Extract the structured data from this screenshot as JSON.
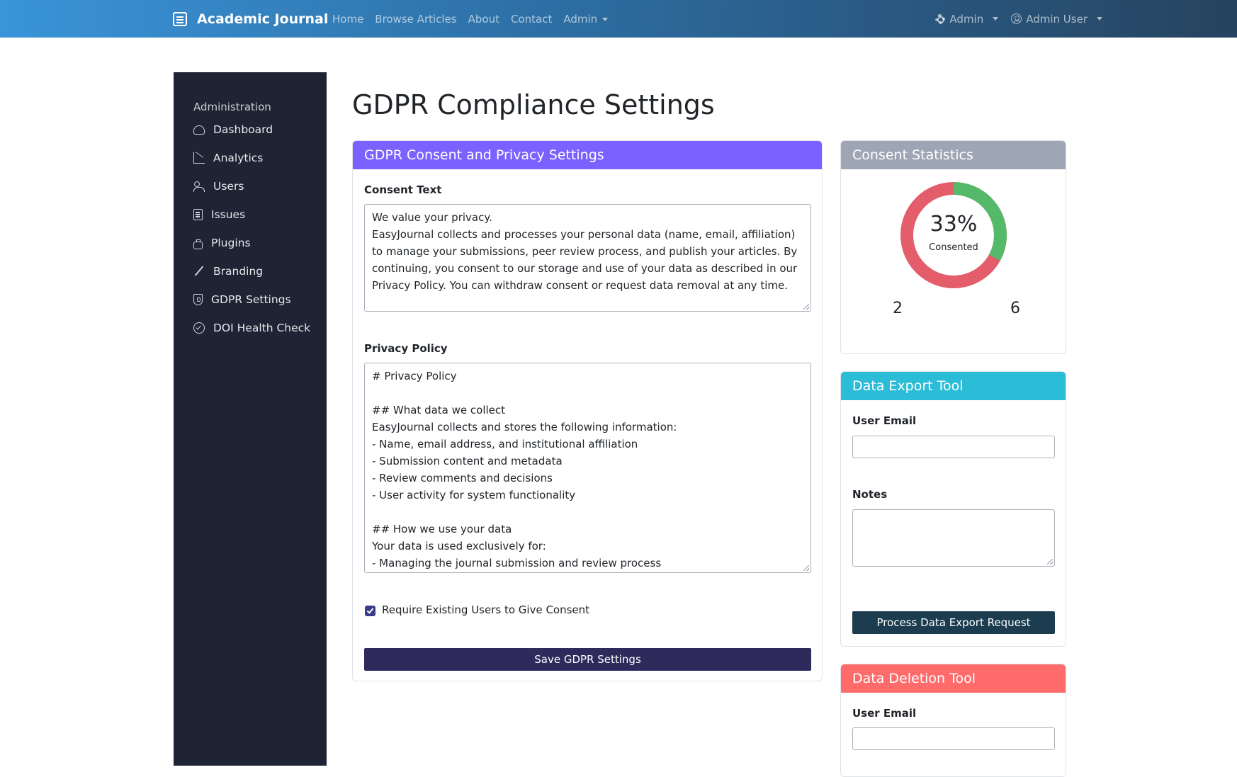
{
  "navbar": {
    "brand": "Academic Journal",
    "links": [
      "Home",
      "Browse Articles",
      "About",
      "Contact",
      "Admin"
    ],
    "right": {
      "admin_menu": "Admin",
      "user_menu": "Admin User"
    }
  },
  "sidebar": {
    "heading": "Administration",
    "items": [
      {
        "label": "Dashboard",
        "icon": "gauge-icon"
      },
      {
        "label": "Analytics",
        "icon": "chart-icon"
      },
      {
        "label": "Users",
        "icon": "users-icon"
      },
      {
        "label": "Issues",
        "icon": "document-icon"
      },
      {
        "label": "Plugins",
        "icon": "plugin-icon"
      },
      {
        "label": "Branding",
        "icon": "brush-icon"
      },
      {
        "label": "GDPR Settings",
        "icon": "shield-icon"
      },
      {
        "label": "DOI Health Check",
        "icon": "check-circle-icon"
      }
    ]
  },
  "page": {
    "title": "GDPR Compliance Settings"
  },
  "consent_card": {
    "header": "GDPR Consent and Privacy Settings",
    "header_color": "#7b61ff",
    "consent_label": "Consent Text",
    "consent_value": "We value your privacy.\nEasyJournal collects and processes your personal data (name, email, affiliation) to manage your submissions, peer review process, and publish your articles. By continuing, you consent to our storage and use of your data as described in our Privacy Policy. You can withdraw consent or request data removal at any time.",
    "privacy_label": "Privacy Policy",
    "privacy_value": "# Privacy Policy\n\n## What data we collect\nEasyJournal collects and stores the following information:\n- Name, email address, and institutional affiliation\n- Submission content and metadata\n- Review comments and decisions\n- User activity for system functionality\n\n## How we use your data\nYour data is used exclusively for:\n- Managing the journal submission and review process",
    "checkbox_label": "Require Existing Users to Give Consent",
    "checkbox_checked": true,
    "save_button": "Save GDPR Settings",
    "save_button_color": "#2e2a5c"
  },
  "stats_card": {
    "header": "Consent Statistics",
    "header_color": "#9ea5b4",
    "percent_label": "33%",
    "center_caption": "Consented",
    "consented_fraction": 0.33,
    "colors": {
      "consented": "#55b96a",
      "not_consented": "#e35d6a"
    },
    "count_left": "2",
    "count_right": "6"
  },
  "export_card": {
    "header": "Data Export Tool",
    "header_color": "#2bbcd8",
    "email_label": "User Email",
    "notes_label": "Notes",
    "button": "Process Data Export Request",
    "button_color": "#1b3d4f"
  },
  "deletion_card": {
    "header": "Data Deletion Tool",
    "header_color": "#ff6b6b",
    "email_label": "User Email"
  }
}
